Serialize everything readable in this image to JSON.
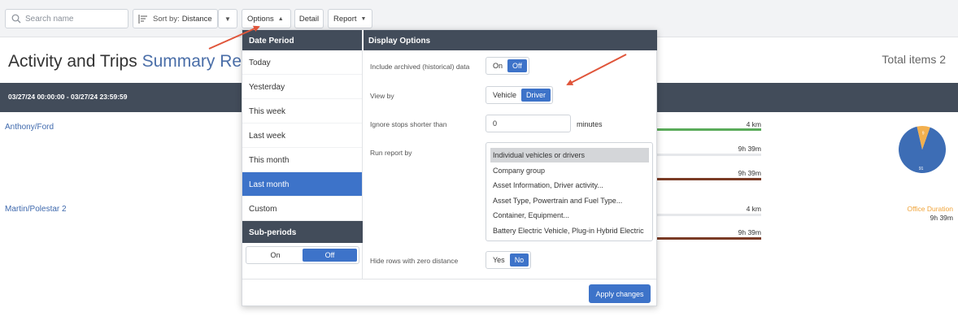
{
  "toolbar": {
    "search_placeholder": "Search name",
    "sort_label": "Sort by:",
    "sort_value": "Distance",
    "options_label": "Options",
    "detail_label": "Detail",
    "report_label": "Report"
  },
  "header": {
    "title": "Activity and Trips",
    "title_sub": "Summary Rep",
    "total_items": "Total items 2"
  },
  "date_range": "03/27/24 00:00:00 - 03/27/24 23:59:59",
  "rows": [
    {
      "name": "Anthony/Ford",
      "distance": "4 km",
      "duration1": "9h 39m",
      "duration2": "9h 39m"
    },
    {
      "name": "Martin/Polestar 2",
      "distance": "4 km",
      "duration1": "9h 39m"
    }
  ],
  "office_duration": {
    "label": "Office Duration",
    "value": "9h 39m"
  },
  "pie": {
    "labels": [
      "91",
      "9"
    ],
    "values": [
      91,
      9
    ],
    "colors": [
      "#3d6db5",
      "#f3b04e"
    ]
  },
  "popup": {
    "date_period_header": "Date Period",
    "periods": [
      "Today",
      "Yesterday",
      "This week",
      "Last week",
      "This month",
      "Last month",
      "Custom"
    ],
    "active_period": "Last month",
    "subperiods_header": "Sub-periods",
    "subperiods_on": "On",
    "subperiods_off": "Off",
    "subperiods_selected": "Off",
    "display_options_header": "Display Options",
    "archived_label": "Include archived (historical) data",
    "archived_on": "On",
    "archived_off": "Off",
    "archived_selected": "Off",
    "view_by_label": "View by",
    "view_vehicle": "Vehicle",
    "view_driver": "Driver",
    "view_selected": "Driver",
    "ignore_stops_label": "Ignore stops shorter than",
    "ignore_stops_value": "0",
    "minutes_label": "minutes",
    "run_report_label": "Run report by",
    "run_report_options": [
      "Individual vehicles or drivers",
      "Company group",
      "Asset Information, Driver activity...",
      "Asset Type, Powertrain and Fuel Type...",
      "Container, Equipment...",
      "Battery Electric Vehicle, Plug-in Hybrid Electric"
    ],
    "run_report_selected": "Individual vehicles or drivers",
    "hide_zero_label": "Hide rows with zero distance",
    "hide_yes": "Yes",
    "hide_no": "No",
    "hide_selected": "No",
    "apply_label": "Apply changes"
  },
  "colors": {
    "accent": "#3d73c9",
    "header_dark": "#424c5a",
    "link": "#3f69ad",
    "annotation_arrow": "#e0553a",
    "distance_bar": "#5aab5a",
    "duration_bar": "#7a3b25",
    "office_label": "#f0a43a"
  }
}
